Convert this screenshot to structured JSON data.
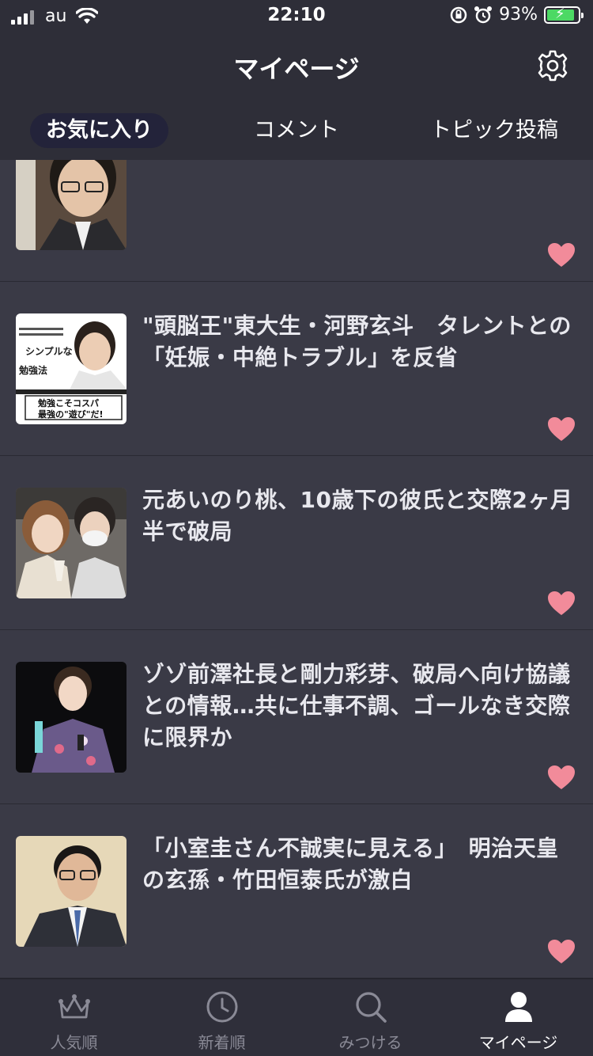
{
  "status_bar": {
    "carrier": "au",
    "time": "22:10",
    "battery": "93%"
  },
  "header": {
    "title": "マイページ",
    "settings_icon": "gear-icon"
  },
  "tabs": [
    {
      "label": "お気に入り",
      "active": true
    },
    {
      "label": "コメント",
      "active": false
    },
    {
      "label": "トピック投稿",
      "active": false
    }
  ],
  "articles": [
    {
      "title": ""
    },
    {
      "title": "\"頭脳王\"東大生・河野玄斗　タレントとの「妊娠・中絶トラブル」を反省"
    },
    {
      "title": "元あいのり桃、10歳下の彼氏と交際2ヶ月半で破局"
    },
    {
      "title": "ゾゾ前澤社長と剛力彩芽、破局へ向け協議との情報…共に仕事不調、ゴールなき交際に限界か"
    },
    {
      "title": "「小室圭さん不誠実に見える」　明治天皇の玄孫・竹田恒泰氏が激白"
    }
  ],
  "thumb2_text": [
    "シンプルな",
    "勉強法",
    "勉強こそコスパ",
    "最強の\"遊び\"だ!"
  ],
  "tabbar": [
    {
      "label": "人気順",
      "icon": "crown-icon",
      "active": false
    },
    {
      "label": "新着順",
      "icon": "clock-icon",
      "active": false
    },
    {
      "label": "みつける",
      "icon": "search-icon",
      "active": false
    },
    {
      "label": "マイページ",
      "icon": "user-icon",
      "active": true
    }
  ],
  "colors": {
    "heart": "#f28b9a",
    "background": "#3a3a46",
    "header": "#2e2e38",
    "active_tab": "#23233a"
  }
}
